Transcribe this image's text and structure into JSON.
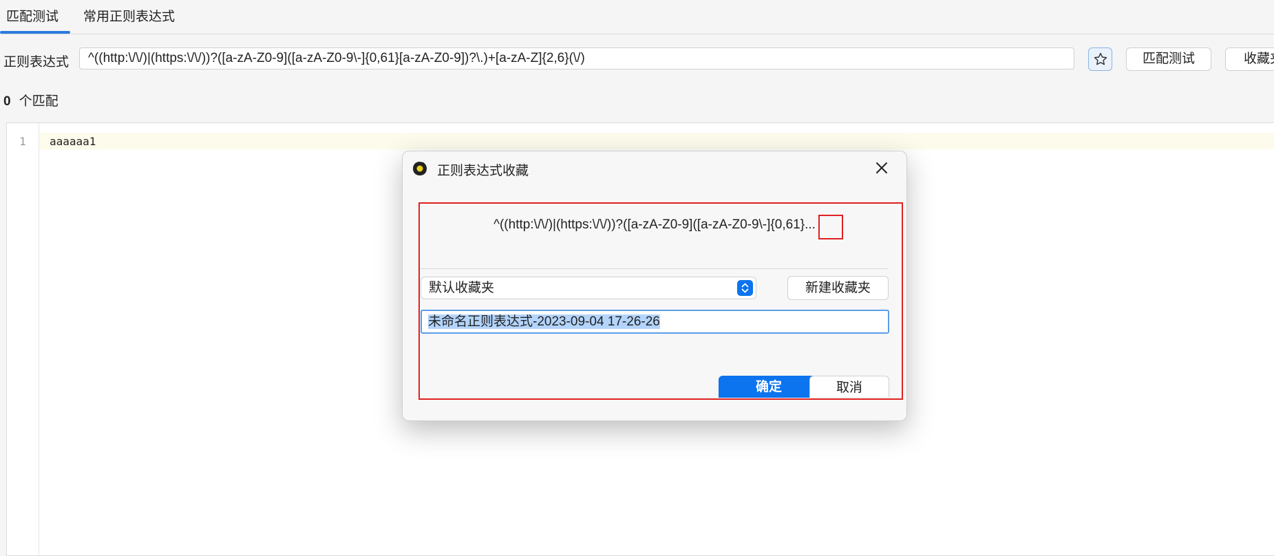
{
  "tabs": [
    {
      "label": "匹配测试",
      "active": true
    },
    {
      "label": "常用正则表达式",
      "active": false
    }
  ],
  "regex_row": {
    "label": "正则表达式",
    "value": "^((http:\\/\\/)|(https:\\/\\/))?([a-zA-Z0-9]([a-zA-Z0-9\\-]{0,61}[a-zA-Z0-9])?\\.)+[a-zA-Z]{2,6}(\\/)",
    "star_icon": "star-icon",
    "match_button": "匹配测试",
    "favorites_button": "收藏夹"
  },
  "match_count": {
    "count": "0",
    "label": "个匹配"
  },
  "editor": {
    "lines": [
      {
        "number": "1",
        "text": "aaaaaa1"
      }
    ]
  },
  "dialog": {
    "title": "正则表达式收藏",
    "logo_icon": "app-logo-icon",
    "close_icon": "close-icon",
    "regex_preview": "^((http:\\/\\/)|(https:\\/\\/))?([a-zA-Z0-9]([a-zA-Z0-9\\-]{0,61}...",
    "folder_select": {
      "value": "默认收藏夹",
      "icon": "select-arrows-icon"
    },
    "new_folder_button": "新建收藏夹",
    "name_input": "未命名正则表达式-2023-09-04  17-26-26",
    "ok_button": "确定",
    "cancel_button": "取消"
  },
  "colors": {
    "accent": "#0b74ee",
    "tab_indicator": "#2b7be0",
    "highlight_frame": "#e02020",
    "selection": "#b3d4fc"
  }
}
